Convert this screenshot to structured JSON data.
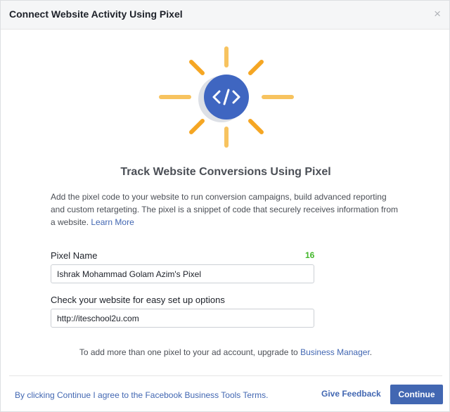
{
  "dialog": {
    "title": "Connect Website Activity Using Pixel",
    "close_symbol": "×"
  },
  "illustration": {
    "icon": "code-icon",
    "sun_ray_color_light": "#f7c35f",
    "sun_ray_color_dark": "#f5a623",
    "badge_color": "#3f66c1"
  },
  "content": {
    "heading": "Track Website Conversions Using Pixel",
    "description": "Add the pixel code to your website to run conversion campaigns, build advanced reporting and custom retargeting. The pixel is a snippet of code that securely receives information from a website.",
    "learn_more": "Learn More"
  },
  "form": {
    "pixel_name_label": "Pixel Name",
    "pixel_name_counter": "16",
    "pixel_name_value": "Ishrak Mohammad Golam Azim's Pixel",
    "website_label": "Check your website for easy set up options",
    "website_value": "http://iteschool2u.com"
  },
  "note": {
    "text": "To add more than one pixel to your ad account, upgrade to",
    "link": "Business Manager",
    "suffix": "."
  },
  "footer": {
    "terms": "By clicking Continue I agree to the Facebook Business Tools Terms.",
    "feedback": "Give Feedback",
    "continue": "Continue"
  }
}
